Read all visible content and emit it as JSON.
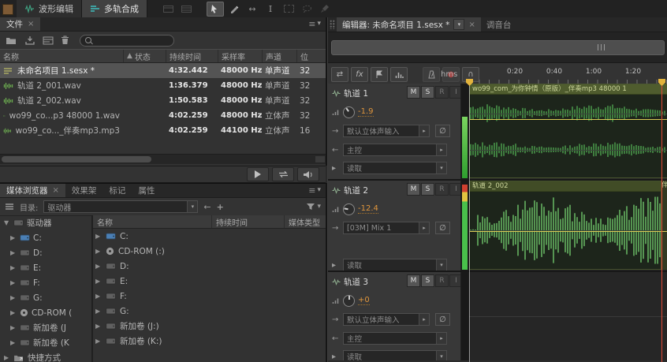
{
  "icons": {
    "close": "×",
    "menu": "≡",
    "sort_asc": "▲",
    "dropdown_down": "▾",
    "dropdown_right": "▸",
    "expand": "▶",
    "collapse": "▼",
    "swap": "⇄",
    "input": "→",
    "output": "←",
    "phase": "∅",
    "headphones": "∩",
    "back": "←",
    "add": "+",
    "record": "●",
    "slip": "↔",
    "ibeam": "I"
  },
  "topbar": {
    "workspace_tabs": [
      {
        "label": "波形编辑"
      },
      {
        "label": "多轨合成"
      }
    ]
  },
  "files_panel": {
    "tab_label": "文件",
    "search_value": "",
    "columns": {
      "name": "名称",
      "status": "状态",
      "duration": "持续时间",
      "sample_rate": "采样率",
      "channels": "声道",
      "bits": "位"
    },
    "rows": [
      {
        "name": "未命名项目 1.sesx *",
        "status": "",
        "duration": "4:32.442",
        "sample_rate": "48000 Hz",
        "channels": "单声道",
        "bits": "32"
      },
      {
        "name": "轨道 2_001.wav",
        "status": "",
        "duration": "1:36.379",
        "sample_rate": "48000 Hz",
        "channels": "单声道",
        "bits": "32"
      },
      {
        "name": "轨道 2_002.wav",
        "status": "",
        "duration": "1:50.583",
        "sample_rate": "48000 Hz",
        "channels": "单声道",
        "bits": "32"
      },
      {
        "name": "wo99_co...p3 48000 1.wav",
        "status": "",
        "duration": "4:02.259",
        "sample_rate": "48000 Hz",
        "channels": "立体声",
        "bits": "32"
      },
      {
        "name": "wo99_co..._伴奏mp3.mp3",
        "status": "",
        "duration": "4:02.259",
        "sample_rate": "44100 Hz",
        "channels": "立体声",
        "bits": "16"
      }
    ]
  },
  "media_browser": {
    "tabs": [
      {
        "label": "媒体浏览器"
      },
      {
        "label": "效果架"
      },
      {
        "label": "标记"
      },
      {
        "label": "属性"
      }
    ],
    "directory_label": "目录:",
    "directory_value": "驱动器",
    "tree": {
      "root": "驱动器",
      "items": [
        "C:",
        "D:",
        "E:",
        "F:",
        "G:",
        "CD-ROM (",
        "新加卷 (J",
        "新加卷 (K"
      ],
      "shortcuts": "快捷方式"
    },
    "list": {
      "columns": {
        "name": "名称",
        "duration": "持续时间",
        "media_type": "媒体类型"
      },
      "rows": [
        "C:",
        "CD-ROM (:)",
        "D:",
        "E:",
        "F:",
        "G:",
        "新加卷 (J:)",
        "新加卷 (K:)"
      ]
    }
  },
  "editor": {
    "tab_label": "编辑器: 未命名项目 1.sesx *",
    "mixer_tab_label": "调音台",
    "toolbar": {
      "fx_label": "fx"
    },
    "ruler": {
      "unit": "hms",
      "ticks": [
        "0:20",
        "0:40",
        "1:00",
        "1:20"
      ]
    },
    "tracks": [
      {
        "name": "轨道 1",
        "mute": "M",
        "solo": "S",
        "record": "R",
        "input_monitor": "I",
        "volume": "-1.9",
        "input": "默认立体声输入",
        "output": "主控",
        "automation": "读取",
        "clip_label": "wo99_com_为你钟情（原版）_伴奏mp3 48000 1"
      },
      {
        "name": "轨道 2",
        "mute": "M",
        "solo": "S",
        "record": "R",
        "input_monitor": "I",
        "volume": "-12.4",
        "input": "[03M] Mix 1",
        "automation": "读取",
        "clip_label": "轨道 2_002",
        "clip2_label": "伴"
      },
      {
        "name": "轨道 3",
        "mute": "M",
        "solo": "S",
        "record": "R",
        "input_monitor": "I",
        "volume": "+0",
        "input": "默认立体声输入",
        "output": "主控",
        "automation": "读取"
      }
    ]
  }
}
